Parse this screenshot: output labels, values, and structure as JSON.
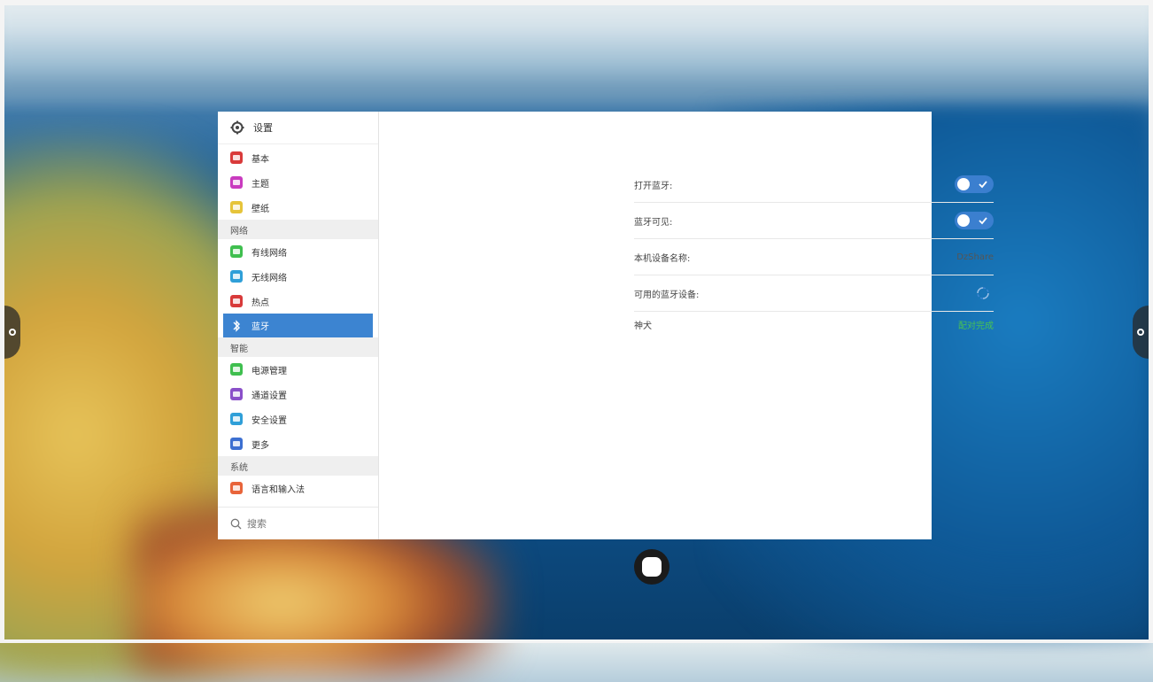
{
  "colors": {
    "accent": "#3c84d1",
    "success": "#48c255",
    "toggle_on": "#3b7fcf"
  },
  "window": {
    "title": "设置",
    "title_icon": "gear-icon"
  },
  "sidebar": {
    "items": [
      {
        "label": "基本",
        "icon": "basic-icon",
        "color": "#d93a3a"
      },
      {
        "label": "主题",
        "icon": "theme-icon",
        "color": "#c93bbf"
      },
      {
        "label": "壁纸",
        "icon": "wallpaper-icon",
        "color": "#e6c43a"
      }
    ],
    "section_network": "网络",
    "network_items": [
      {
        "label": "有线网络",
        "icon": "wired-network-icon",
        "color": "#3fbf4f"
      },
      {
        "label": "无线网络",
        "icon": "wifi-icon",
        "color": "#2f9fd8"
      },
      {
        "label": "热点",
        "icon": "hotspot-icon",
        "color": "#d83a3a"
      },
      {
        "label": "蓝牙",
        "icon": "bluetooth-icon",
        "color": "#3c84d1",
        "active": true
      }
    ],
    "section_smart": "智能",
    "smart_items": [
      {
        "label": "电源管理",
        "icon": "power-icon",
        "color": "#3fbf4f"
      },
      {
        "label": "通道设置",
        "icon": "channel-icon",
        "color": "#8a4fc9"
      },
      {
        "label": "安全设置",
        "icon": "security-icon",
        "color": "#2f9fd8"
      },
      {
        "label": "更多",
        "icon": "more-icon",
        "color": "#3c6fd1"
      }
    ],
    "section_system": "系统",
    "system_items": [
      {
        "label": "语言和输入法",
        "icon": "language-icon",
        "color": "#e8643a"
      }
    ],
    "search_placeholder": "搜索"
  },
  "bluetooth": {
    "open_label": "打开蓝牙:",
    "open_on": true,
    "visible_label": "蓝牙可见:",
    "visible_on": true,
    "device_name_label": "本机设备名称:",
    "device_name_value": "DzShare",
    "available_label": "可用的蓝牙设备:",
    "device_entry": {
      "name": "神犬",
      "status": "配对完成"
    }
  }
}
